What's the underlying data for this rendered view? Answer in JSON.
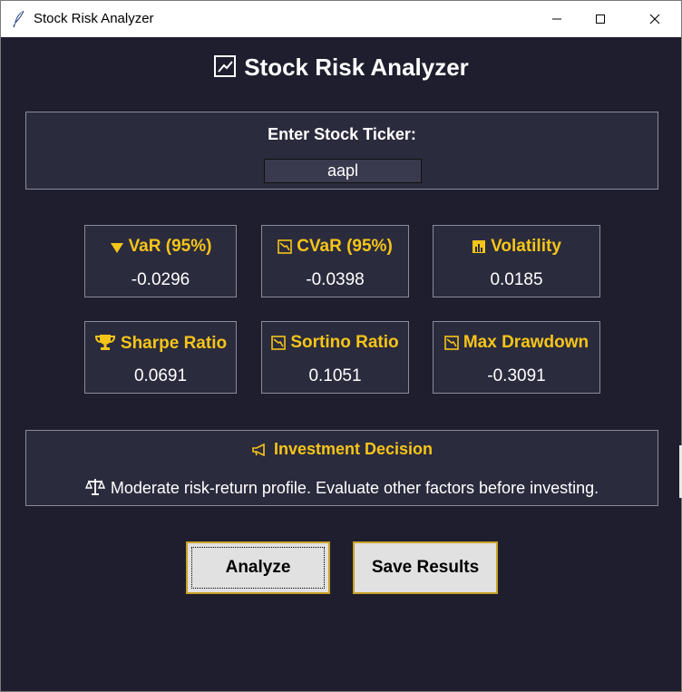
{
  "window": {
    "title": "Stock Risk Analyzer"
  },
  "header": {
    "title": "Stock Risk Analyzer",
    "icon": "chart-checkbox-icon"
  },
  "ticker": {
    "label": "Enter Stock Ticker:",
    "value": "aapl"
  },
  "metrics": [
    {
      "icon": "down-triangle-icon",
      "label": "VaR (95%)",
      "value": "-0.0296"
    },
    {
      "icon": "chart-down-icon",
      "label": "CVaR (95%)",
      "value": "-0.0398"
    },
    {
      "icon": "bar-chart-icon",
      "label": "Volatility",
      "value": "0.0185"
    },
    {
      "icon": "trophy-icon",
      "label": "Sharpe Ratio",
      "value": "0.0691"
    },
    {
      "icon": "chart-down-icon",
      "label": "Sortino Ratio",
      "value": "0.1051"
    },
    {
      "icon": "chart-down-icon",
      "label": "Max Drawdown",
      "value": "-0.3091"
    }
  ],
  "decision": {
    "title_icon": "megaphone-icon",
    "title": "Investment Decision",
    "text_icon": "scales-icon",
    "text": "Moderate risk-return profile. Evaluate other factors before investing."
  },
  "buttons": {
    "analyze": "Analyze",
    "save": "Save Results"
  },
  "colors": {
    "background": "#1e1e2e",
    "panel": "#2b2b3e",
    "accent": "#f5c518",
    "text": "#ffffff"
  }
}
